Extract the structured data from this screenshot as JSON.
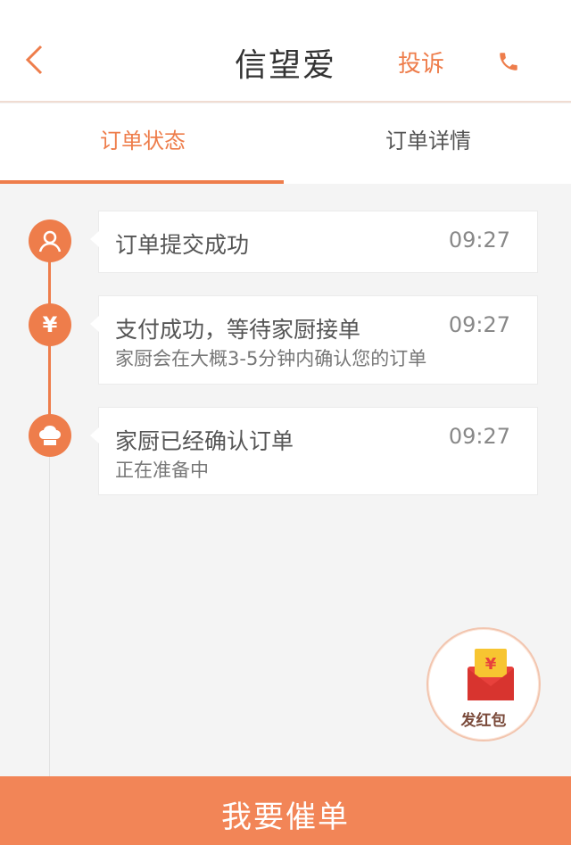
{
  "header": {
    "back_icon": "chevron-left-icon",
    "title": "信望爱",
    "complain_label": "投诉",
    "phone_icon": "phone-icon"
  },
  "tabs": [
    {
      "label": "订单状态",
      "active": true
    },
    {
      "label": "订单详情",
      "active": false
    }
  ],
  "timeline": [
    {
      "icon": "user-icon",
      "title": "订单提交成功",
      "time": "09:27",
      "subtitle": ""
    },
    {
      "icon": "yen-icon",
      "title": "支付成功，等待家厨接单",
      "time": "09:27",
      "subtitle": "家厨会在大概3-5分钟内确认您的订单"
    },
    {
      "icon": "chef-hat-icon",
      "title": "家厨已经确认订单",
      "time": "09:27",
      "subtitle": "正在准备中"
    }
  ],
  "red_packet": {
    "label": "发红包",
    "symbol": "¥"
  },
  "bottom_button": {
    "label": "我要催单"
  },
  "colors": {
    "accent": "#ee7d4b",
    "bottom_bar": "#f28557",
    "background": "#f4f4f4"
  }
}
